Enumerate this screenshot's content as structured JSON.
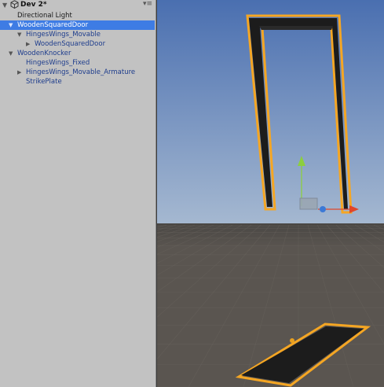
{
  "hierarchy": {
    "scene_title": "Dev 2*",
    "items": [
      {
        "label": "Directional Light",
        "indent": 0,
        "arrow": "",
        "selected": false,
        "prefab": false
      },
      {
        "label": "WoodenSquaredDoor",
        "indent": 0,
        "arrow": "▼",
        "selected": true,
        "prefab": true
      },
      {
        "label": "HingesWings_Movable",
        "indent": 1,
        "arrow": "▼",
        "selected": false,
        "prefab": true
      },
      {
        "label": "WoodenSquaredDoor",
        "indent": 2,
        "arrow": "▶",
        "selected": false,
        "prefab": true
      },
      {
        "label": "WoodenKnocker",
        "indent": 0,
        "arrow": "▼",
        "selected": false,
        "prefab": true
      },
      {
        "label": "HingesWings_Fixed",
        "indent": 1,
        "arrow": "",
        "selected": false,
        "prefab": true
      },
      {
        "label": "HingesWings_Movable_Armature",
        "indent": 1,
        "arrow": "▶",
        "selected": false,
        "prefab": true
      },
      {
        "label": "StrikePlate",
        "indent": 1,
        "arrow": "",
        "selected": false,
        "prefab": true
      }
    ]
  },
  "scene_view": {
    "sky_top": "#4a6fb0",
    "sky_horizon": "#a6b9d1",
    "ground": "#5a5550",
    "grid_line": "#6a655f",
    "outline": "#f5a623",
    "object_fill": "#1c1c1c",
    "gizmo_x": "#e0462a",
    "gizmo_y": "#8ccf3e",
    "gizmo_z": "#3c79d6"
  }
}
